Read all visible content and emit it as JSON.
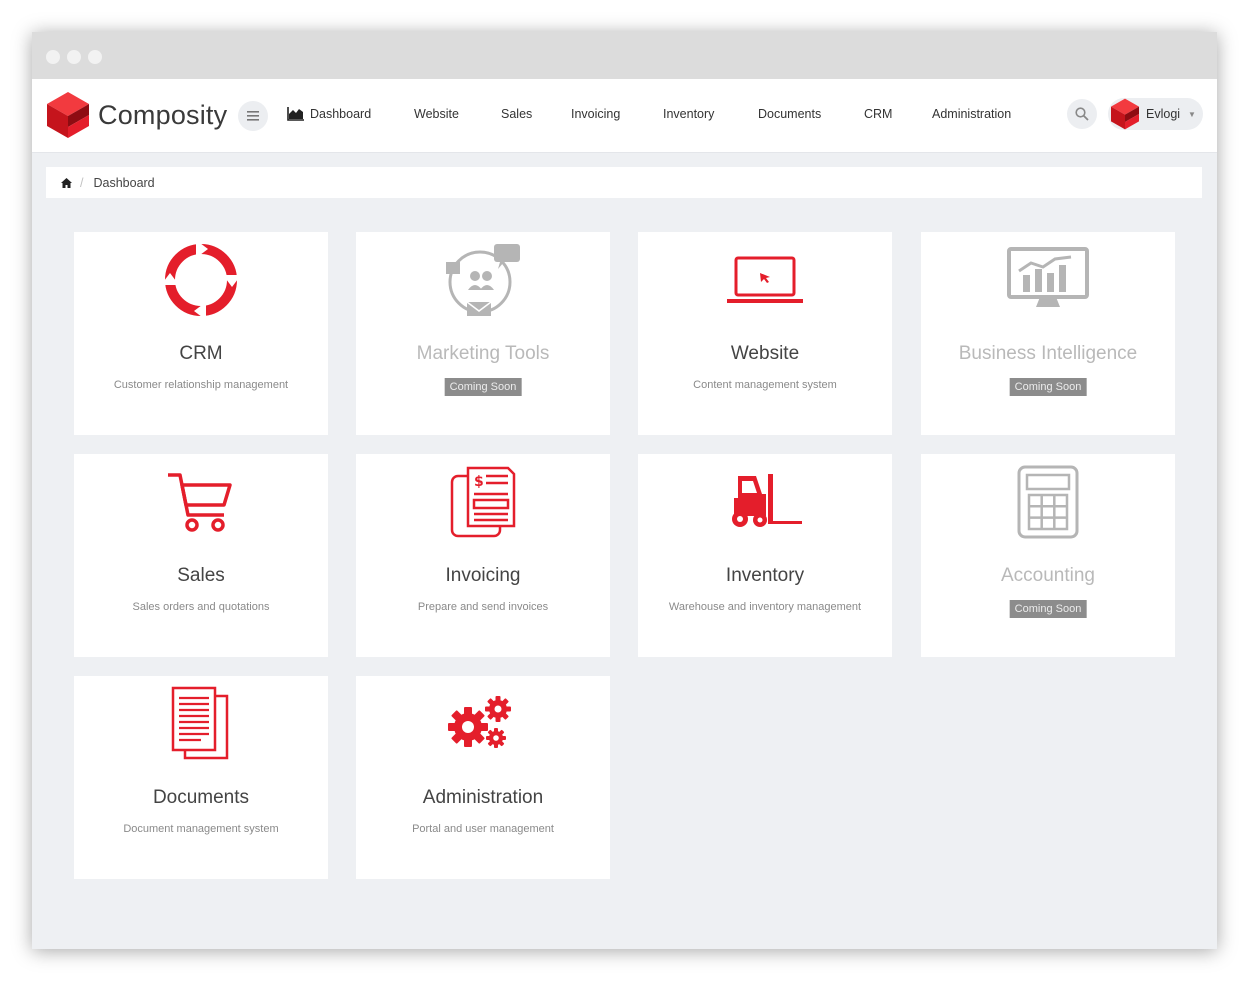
{
  "app": {
    "name": "Composity",
    "brand_color": "#e41e2b"
  },
  "nav": {
    "items": [
      {
        "label": "Dashboard",
        "icon": "area-chart-icon"
      },
      {
        "label": "Website"
      },
      {
        "label": "Sales"
      },
      {
        "label": "Invoicing"
      },
      {
        "label": "Inventory"
      },
      {
        "label": "Documents"
      },
      {
        "label": "CRM"
      },
      {
        "label": "Administration"
      }
    ]
  },
  "user": {
    "name": "Evlogi"
  },
  "breadcrumb": {
    "home_icon": "home-icon",
    "current": "Dashboard"
  },
  "cards": [
    {
      "title": "CRM",
      "description": "Customer relationship management",
      "icon": "crm-cycle-icon",
      "enabled": true
    },
    {
      "title": "Marketing Tools",
      "badge": "Coming Soon",
      "icon": "marketing-icon",
      "enabled": false
    },
    {
      "title": "Website",
      "description": "Content management system",
      "icon": "laptop-icon",
      "enabled": true
    },
    {
      "title": "Business Intelligence",
      "badge": "Coming Soon",
      "icon": "bi-chart-icon",
      "enabled": false
    },
    {
      "title": "Sales",
      "description": "Sales orders and quotations",
      "icon": "shopping-cart-icon",
      "enabled": true
    },
    {
      "title": "Invoicing",
      "description": "Prepare and send invoices",
      "icon": "invoice-icon",
      "enabled": true
    },
    {
      "title": "Inventory",
      "description": "Warehouse and inventory management",
      "icon": "forklift-icon",
      "enabled": true
    },
    {
      "title": "Accounting",
      "badge": "Coming Soon",
      "icon": "calculator-icon",
      "enabled": false
    },
    {
      "title": "Documents",
      "description": "Document management system",
      "icon": "documents-icon",
      "enabled": true
    },
    {
      "title": "Administration",
      "description": "Portal and user management",
      "icon": "gears-icon",
      "enabled": true
    }
  ]
}
